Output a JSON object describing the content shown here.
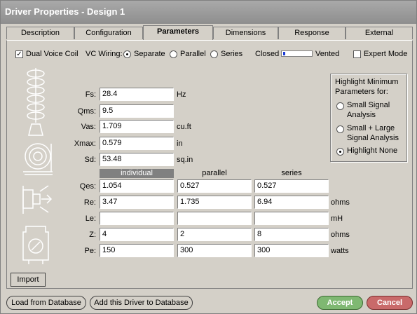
{
  "window": {
    "title": "Driver Properties - Design 1"
  },
  "tabs": [
    "Description",
    "Configuration",
    "Parameters",
    "Dimensions",
    "Response",
    "External"
  ],
  "active_tab": "Parameters",
  "top_row": {
    "dual_voice_coil_label": "Dual Voice Coil",
    "dual_voice_coil_checked": true,
    "vc_wiring_label": "VC Wiring:",
    "wiring_options": [
      "Separate",
      "Parallel",
      "Series"
    ],
    "wiring_selected": "Separate",
    "closed_label": "Closed",
    "vented_label": "Vented",
    "expert_mode_label": "Expert Mode",
    "expert_mode_checked": false
  },
  "params": [
    {
      "name": "Fs:",
      "value": "28.4",
      "unit": "Hz"
    },
    {
      "name": "Qms:",
      "value": "9.5",
      "unit": ""
    },
    {
      "name": "Vas:",
      "value": "1.709",
      "unit": "cu.ft"
    },
    {
      "name": "Xmax:",
      "value": "0.579",
      "unit": "in"
    },
    {
      "name": "Sd:",
      "value": "53.48",
      "unit": "sq.in"
    }
  ],
  "columns": [
    "individual",
    "parallel",
    "series"
  ],
  "coil_rows": [
    {
      "name": "Qes:",
      "values": [
        "1.054",
        "0.527",
        "0.527"
      ],
      "unit": ""
    },
    {
      "name": "Re:",
      "values": [
        "3.47",
        "1.735",
        "6.94"
      ],
      "unit": "ohms"
    },
    {
      "name": "Le:",
      "values": [
        "",
        "",
        ""
      ],
      "unit": "mH"
    },
    {
      "name": "Z:",
      "values": [
        "4",
        "2",
        "8"
      ],
      "unit": "ohms"
    },
    {
      "name": "Pe:",
      "values": [
        "150",
        "300",
        "300"
      ],
      "unit": "watts"
    }
  ],
  "highlight": {
    "title_line1": "Highlight Minimum",
    "title_line2": "Parameters for:",
    "opt1_line1": "Small Signal",
    "opt1_line2": "Analysis",
    "opt2_line1": "Small + Large",
    "opt2_line2": "Signal Analysis",
    "opt3": "Highlight None",
    "selected": "Highlight None"
  },
  "buttons": {
    "import": "Import",
    "load": "Load from Database",
    "add": "Add this Driver to Database",
    "accept": "Accept",
    "cancel": "Cancel"
  }
}
